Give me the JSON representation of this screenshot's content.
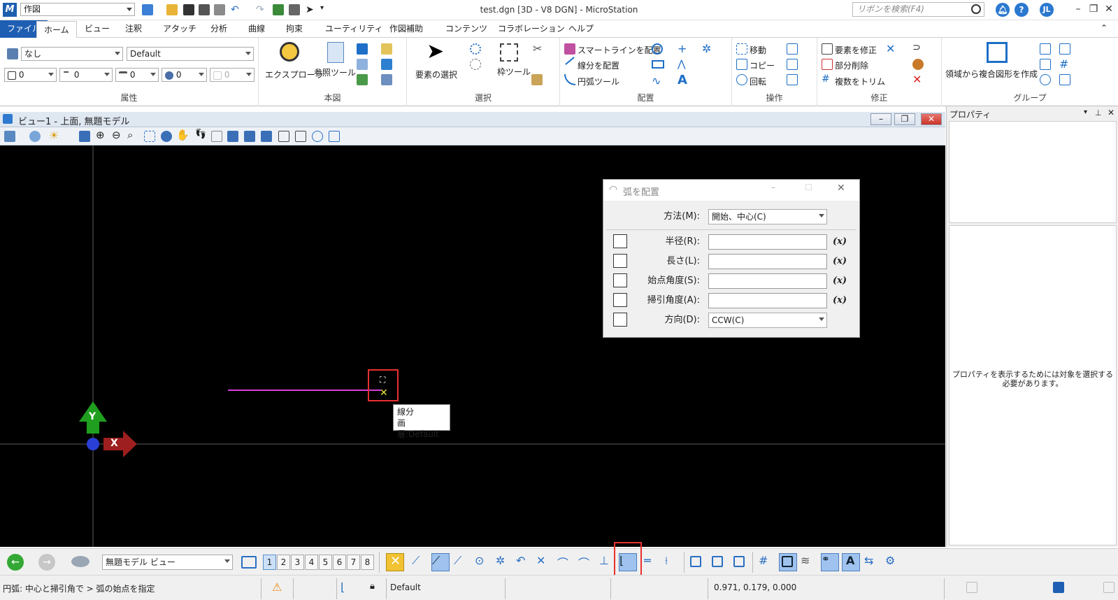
{
  "window": {
    "workflow": "作図",
    "title": "test.dgn [3D - V8 DGN] - MicroStation",
    "search_placeholder": "リボンを検索(F4)",
    "user_initials": "JL"
  },
  "tabs": [
    "ファイル",
    "ホーム",
    "ビュー",
    "注釈",
    "アタッチ",
    "分析",
    "曲線",
    "拘束",
    "ユーティリティ",
    "作図補助",
    "コンテンツ",
    "コラボレーション",
    "ヘルプ"
  ],
  "ribbon": {
    "attributes": {
      "level": "なし",
      "style": "Default",
      "color": "0",
      "weight": "0",
      "linestyle": "0",
      "transparency": "0",
      "priority": "0",
      "label": "属性"
    },
    "primary": {
      "explorer": "エクスプローラ",
      "reference": "参照ツール",
      "label": "本図"
    },
    "selection": {
      "select": "要素の選択",
      "fence": "枠ツール",
      "label": "選択"
    },
    "placement": {
      "smartline": "スマートラインを配置",
      "line": "線分を配置",
      "arc": "円弧ツール",
      "label": "配置"
    },
    "manipulate": {
      "move": "移動",
      "copy": "コピー",
      "rotate": "回転",
      "label": "操作"
    },
    "modify": {
      "modify": "要素を修正",
      "partial": "部分削除",
      "trim": "複数をトリム",
      "label": "修正"
    },
    "groups": {
      "region": "領域から複合図形を作成",
      "label": "グループ"
    }
  },
  "view": {
    "title": "ビュー1 - 上面, 無題モデル",
    "tooltip_line1": "線分",
    "tooltip_line2": "画層:Default",
    "axis_y": "Y",
    "axis_x": "X"
  },
  "properties": {
    "title": "プロパティ",
    "message": "プロパティを表示するためには対象を選択する必要があります。"
  },
  "dialog": {
    "title": "弧を配置",
    "method_label": "方法(M):",
    "method_value": "開始、中心(C)",
    "fields": [
      {
        "label": "半径(R):",
        "value": ""
      },
      {
        "label": "長さ(L):",
        "value": ""
      },
      {
        "label": "始点角度(S):",
        "value": ""
      },
      {
        "label": "掃引角度(A):",
        "value": ""
      }
    ],
    "direction_label": "方向(D):",
    "direction_value": "CCW(C)",
    "fx": "(x)"
  },
  "bottom": {
    "model_view": "無題モデル ビュー",
    "views": [
      "1",
      "2",
      "3",
      "4",
      "5",
      "6",
      "7",
      "8"
    ]
  },
  "status": {
    "prompt": "円弧: 中心と掃引角で > 弧の始点を指定",
    "level": "Default",
    "coords": "0.971, 0.179, 0.000"
  },
  "colors": {
    "accent": "#1e5fb4",
    "line": "#d93fd9",
    "highlight": "#e83030"
  }
}
